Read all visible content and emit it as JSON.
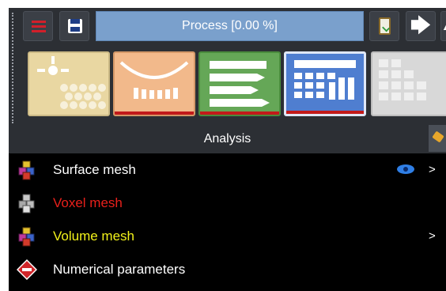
{
  "toolbar": {
    "menu_icon": "menu-icon",
    "save_icon": "save-icon",
    "process_label": "Process [0.00 %]",
    "clipboard_icon": "clipboard-check-icon",
    "next_icon": "arrow-right-icon",
    "next_glyph": "🡆",
    "up_glyph": "▲"
  },
  "tiles": [
    {
      "name": "microstructure",
      "icon": "sun-structure-icon",
      "color": "#e9d7a2"
    },
    {
      "name": "geometry",
      "icon": "curved-surface-icon",
      "color": "#f2b98b"
    },
    {
      "name": "mesh-rules",
      "icon": "pencil-list-icon",
      "color": "#65a757"
    },
    {
      "name": "analysis",
      "icon": "grid-table-icon",
      "color": "#4f7ed0",
      "selected": true
    },
    {
      "name": "results",
      "icon": "grey-grid-icon",
      "color": "#d8d8d8"
    }
  ],
  "tab": {
    "title": "Analysis"
  },
  "tree": [
    {
      "label": "Surface mesh",
      "color": "#ffffff",
      "icon": "cubes-icon",
      "eye": true,
      "chevron": ">"
    },
    {
      "label": "Voxel mesh",
      "color": "#e8201b",
      "icon": "gray-cubes-icon",
      "eye": false,
      "chevron": ""
    },
    {
      "label": "Volume mesh",
      "color": "#f2f21a",
      "icon": "cubes-icon",
      "eye": false,
      "chevron": ">"
    },
    {
      "label": "Numerical parameters",
      "color": "#ffffff",
      "icon": "red-diamond-icon",
      "eye": false,
      "chevron": ""
    }
  ],
  "colors": {
    "accent": "#c21a1a",
    "panel_bg": "#2c2f34",
    "tree_bg": "#000000"
  }
}
